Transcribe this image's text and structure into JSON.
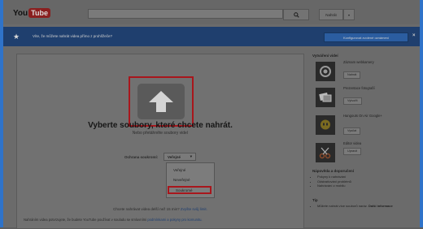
{
  "header": {
    "logo_you": "You",
    "logo_tube": "Tube",
    "upload_label": "Nahrát",
    "upload_dropdown": "▾"
  },
  "notice": {
    "text": "Víte, že můžete nahrát videa přímo z prohlížeče?",
    "button": "Konfigurovat zvolené oznámení",
    "close": "×"
  },
  "upload": {
    "title": "Vyberte soubory, které chcete nahrát.",
    "subtitle": "Nebo přetáhněte soubory videí",
    "privacy_label": "Ochrana soukromí:",
    "privacy_value": "Veřejné",
    "privacy_options": [
      "Veřejné",
      "Neveřejné",
      "Soukromé"
    ],
    "footer_line1": "Chcete nahrávat videa delší než 15 min?",
    "footer_line1_link": "Zvyšte svůj limit.",
    "footer_line2": "Nahráním videa potvrzujete, že budete YouTube používat v souladu se smluvními",
    "footer_line2_link": "podmínkami a pokyny pro komunitu."
  },
  "sidebar": {
    "heading": "Vytváření videí",
    "tools": [
      {
        "name": "Záznam webkamery",
        "button": "Nahrát",
        "icon": "record-icon"
      },
      {
        "name": "Prezentace fotografií",
        "button": "Vytvořit",
        "icon": "photos-icon"
      },
      {
        "name": "Hangouts On Air Google+",
        "button": "Vysílat",
        "icon": "hangouts-icon"
      },
      {
        "name": "Editor videa",
        "button": "Upravit",
        "icon": "scissors-icon"
      }
    ],
    "help_heading": "Nápověda a doporučení",
    "help_items": [
      "Pokyny k nahrávání",
      "Odstraňování problémů",
      "Nahrávání z mobilu"
    ],
    "tip_heading": "Tip",
    "tip_text": "Můžete nahrát více souborů naráz.",
    "tip_link": "Další informace"
  }
}
